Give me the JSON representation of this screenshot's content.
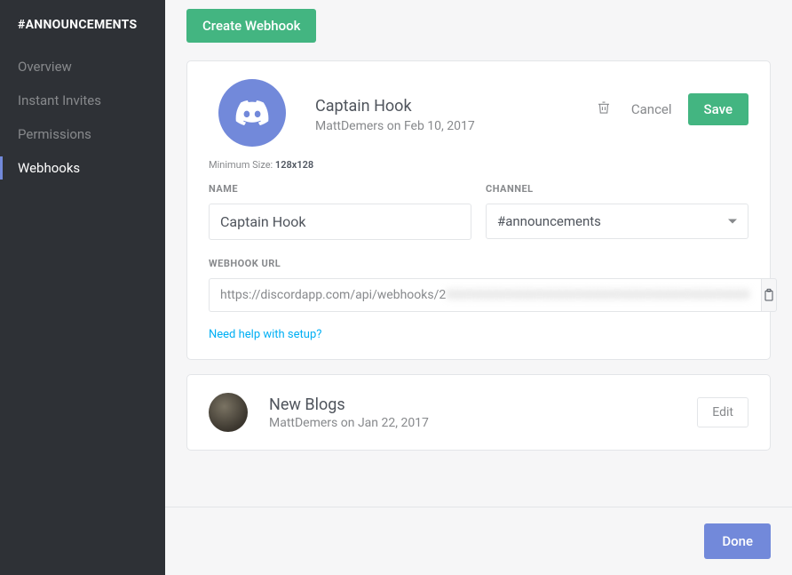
{
  "sidebar": {
    "title": "#ANNOUNCEMENTS",
    "items": [
      {
        "label": "Overview"
      },
      {
        "label": "Instant Invites"
      },
      {
        "label": "Permissions"
      },
      {
        "label": "Webhooks"
      }
    ]
  },
  "header": {
    "create_button": "Create Webhook"
  },
  "webhook_editor": {
    "title": "Captain Hook",
    "meta": "MattDemers on Feb 10, 2017",
    "min_size_label": "Minimum Size: ",
    "min_size_value": "128x128",
    "actions": {
      "cancel": "Cancel",
      "save": "Save"
    },
    "fields": {
      "name_label": "NAME",
      "name_value": "Captain Hook",
      "channel_label": "CHANNEL",
      "channel_value": "#announcements",
      "url_label": "WEBHOOK URL",
      "url_visible": "https://discordapp.com/api/webhooks/2",
      "url_hidden": "XXXXXXXXXXXXXXXXXXXXXXXXXXXXXXXXXXXXXXX"
    },
    "help_link": "Need help with setup?"
  },
  "webhook_collapsed": {
    "title": "New Blogs",
    "meta": "MattDemers on Jan 22, 2017",
    "edit_button": "Edit"
  },
  "footer": {
    "done_button": "Done"
  }
}
